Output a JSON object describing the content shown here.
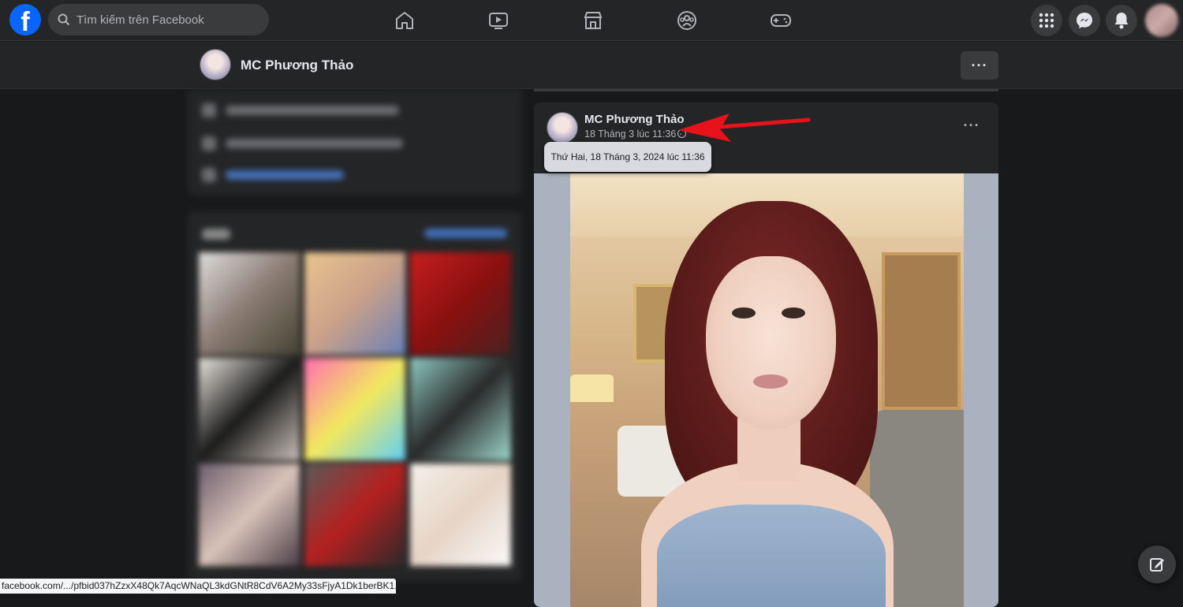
{
  "topbar": {
    "logo_letter": "f",
    "search_placeholder": "Tìm kiếm trên Facebook",
    "nav_icons": [
      "home-icon",
      "video-icon",
      "marketplace-icon",
      "groups-icon",
      "gaming-icon"
    ],
    "right_icons": [
      "menu-grid-icon",
      "messenger-icon",
      "notifications-icon"
    ],
    "brand_color": "#0866ff"
  },
  "subheader": {
    "profile_name": "MC Phương Thảo",
    "more_label": "···"
  },
  "post": {
    "author": "MC Phương Thảo",
    "timestamp": "18 Tháng 3 lúc 11:36 ·",
    "privacy_icon": "globe-icon",
    "more_label": "···",
    "tooltip": "Thứ Hai, 18 Tháng 3, 2024 lúc 11:36"
  },
  "annotation": {
    "arrow_color": "#e8121a"
  },
  "status_bar": {
    "url": "facebook.com/.../pfbid037hZzxX48Qk7AqcWNaQL3kdGNtR8CdV6A2My33sFjyA1Dk1berBK1..."
  },
  "compose_icon": "new-message-icon"
}
